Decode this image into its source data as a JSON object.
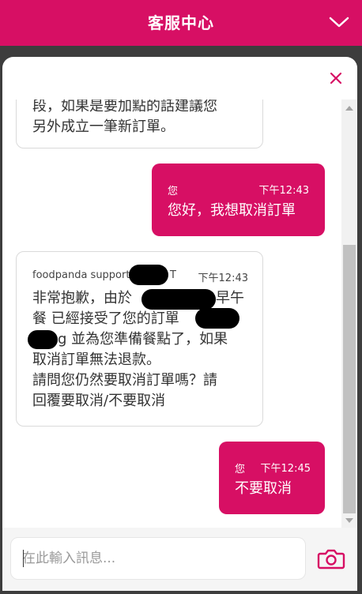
{
  "header": {
    "title": "客服中心",
    "collapse_icon": "chevron-down-icon"
  },
  "panel": {
    "close_icon": "close-icon"
  },
  "messages": [
    {
      "role": "agent",
      "lines": [
        "段，如果是要加點的話建議您",
        "另外成立一筆新訂單。"
      ]
    },
    {
      "role": "user",
      "sender": "您",
      "time": "下午12:43",
      "text": "您好，我想取消訂單"
    },
    {
      "role": "agent",
      "sender": "foodpanda support",
      "sender_suffix": "T",
      "time": "下午12:43",
      "lines": [
        "非常抱歉，由於",
        "早午",
        "餐 已經接受了您的訂單",
        "g 並為您準備餐點了，如果",
        "取消訂單無法退款。",
        "請問您仍然要取消訂單嗎？請",
        "回覆要取消/不要取消"
      ]
    },
    {
      "role": "user",
      "sender": "您",
      "time": "下午12:45",
      "text": "不要取消"
    }
  ],
  "composer": {
    "placeholder": "在此輸入訊息...",
    "value": "",
    "camera_icon": "camera-icon"
  },
  "colors": {
    "brand": "#d70f64",
    "background": "#3d3d3d",
    "bubble_border": "#dadada"
  }
}
